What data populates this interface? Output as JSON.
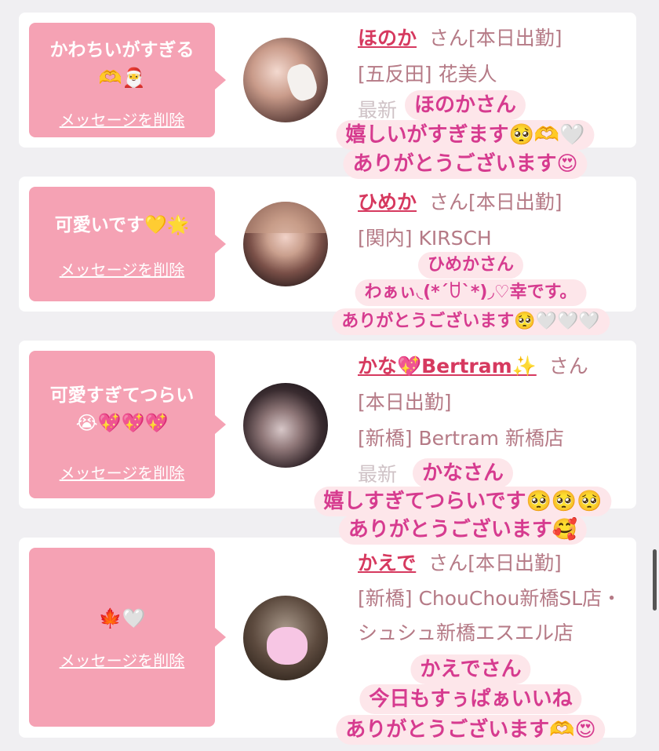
{
  "delete_label": "メッセージを削除",
  "cards": [
    {
      "message": "かわちいがすぎる",
      "emojis": "🫶🎅",
      "name": "ほのか",
      "san": "さん",
      "status": "[本日出勤]",
      "shop": "[五反田] 花美人",
      "faded": "最新",
      "caption": [
        "ほのかさん",
        "嬉しいがすぎます🥺🫶🤍",
        "ありがとうございます😍"
      ]
    },
    {
      "message": "可愛いです💛🌟",
      "emojis": "",
      "name": "ひめか",
      "san": "さん",
      "status": "[本日出勤]",
      "shop": "[関内] KIRSCH",
      "faded": "",
      "caption": [
        "ひめかさん",
        "わぁぃ◟(*´ꇴ`*)◞♡幸です。",
        "ありがとうございます🥺🤍🤍🤍"
      ]
    },
    {
      "message": "可愛すぎてつらい",
      "emojis": "😭💖💖💖",
      "name": "かな💖Bertram✨",
      "san": "さん",
      "status": "[本日出勤]",
      "shop": "[新橋] Bertram 新橋店",
      "faded": "最新",
      "caption": [
        "かなさん",
        "嬉しすぎてつらいです🥺🥺🥺",
        "ありがとうございます🥰"
      ]
    },
    {
      "message": "",
      "emojis": "🍁🤍",
      "name": "かえで",
      "san": "さん",
      "status": "[本日出勤]",
      "shop": "[新橋] ChouChou新橋SL店・シュシュ新橋エスエル店",
      "faded": "",
      "caption": [
        "かえでさん",
        "今日もすぅぱぁいいね",
        "ありがとうございます🫶😍"
      ]
    }
  ],
  "colors": {
    "background": "#f0eff2",
    "bubble": "#f5a2b4",
    "name": "#d6395f",
    "caption_text": "#d63b8f",
    "caption_bg": "#fde6ea"
  }
}
